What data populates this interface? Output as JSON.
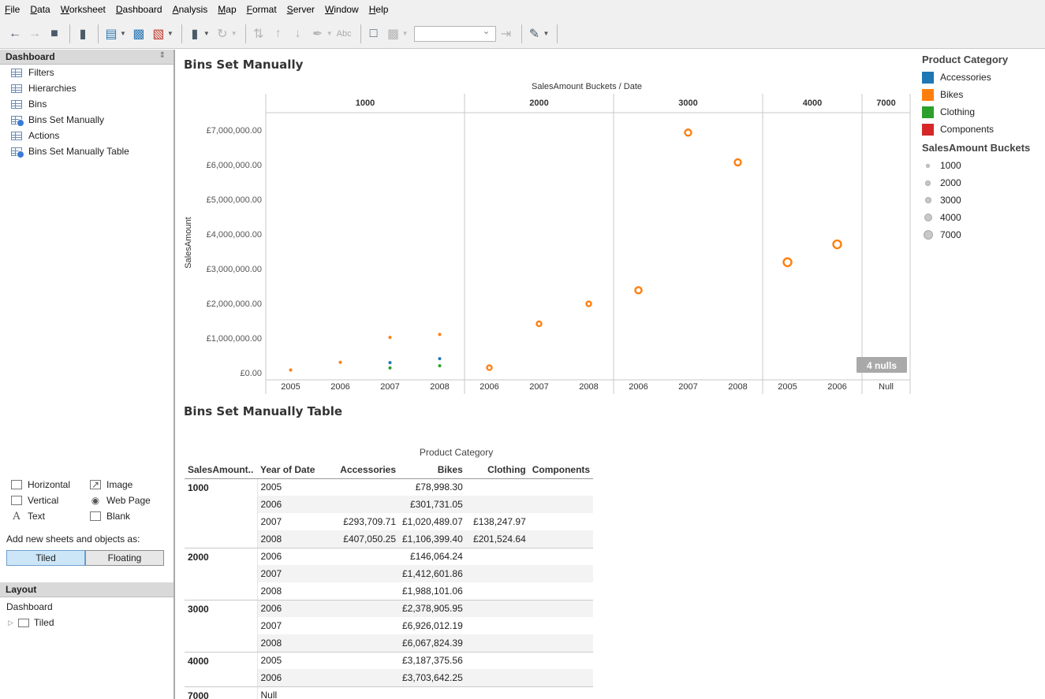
{
  "menu": [
    "File",
    "Data",
    "Worksheet",
    "Dashboard",
    "Analysis",
    "Map",
    "Format",
    "Server",
    "Window",
    "Help"
  ],
  "toolbar": {
    "text_button": "Abc"
  },
  "dashboard_panel": {
    "title": "Dashboard",
    "sheets": [
      {
        "label": "Filters",
        "used": false
      },
      {
        "label": "Hierarchies",
        "used": false
      },
      {
        "label": "Bins",
        "used": false
      },
      {
        "label": "Bins Set Manually",
        "used": true
      },
      {
        "label": "Actions",
        "used": false
      },
      {
        "label": "Bins Set Manually Table",
        "used": true
      }
    ]
  },
  "objects": {
    "horizontal": "Horizontal",
    "image": "Image",
    "vertical": "Vertical",
    "web_page": "Web Page",
    "text": "Text",
    "blank": "Blank"
  },
  "add_new": {
    "label": "Add new sheets and objects as:",
    "tiled": "Tiled",
    "floating": "Floating"
  },
  "layout_panel": {
    "title": "Layout",
    "root": "Dashboard",
    "child": "Tiled"
  },
  "chart_title": "Bins Set Manually",
  "table_title": "Bins Set Manually Table",
  "legend": {
    "color_title": "Product Category",
    "colors": [
      {
        "label": "Accessories",
        "color": "#1f77b4"
      },
      {
        "label": "Bikes",
        "color": "#ff7f0e"
      },
      {
        "label": "Clothing",
        "color": "#2ca02c"
      },
      {
        "label": "Components",
        "color": "#d62728"
      }
    ],
    "size_title": "SalesAmount Buckets",
    "sizes": [
      "1000",
      "2000",
      "3000",
      "4000",
      "7000"
    ]
  },
  "chart_data": {
    "type": "scatter",
    "header_title": "SalesAmount Buckets  /  Date",
    "ylabel": "SalesAmount",
    "ylim": [
      0,
      7500000
    ],
    "y_ticks": [
      "£0.00",
      "£1,000,000.00",
      "£2,000,000.00",
      "£3,000,000.00",
      "£4,000,000.00",
      "£5,000,000.00",
      "£6,000,000.00",
      "£7,000,000.00"
    ],
    "y_tick_values": [
      0,
      1000000,
      2000000,
      3000000,
      4000000,
      5000000,
      6000000,
      7000000
    ],
    "null_badge": "4 nulls",
    "panes": [
      {
        "bucket": "1000",
        "years": [
          "2005",
          "2006",
          "2007",
          "2008"
        ]
      },
      {
        "bucket": "2000",
        "years": [
          "2006",
          "2007",
          "2008"
        ]
      },
      {
        "bucket": "3000",
        "years": [
          "2006",
          "2007",
          "2008"
        ]
      },
      {
        "bucket": "4000",
        "years": [
          "2005",
          "2006"
        ]
      },
      {
        "bucket": "7000",
        "years": [
          "Null"
        ]
      }
    ],
    "points": [
      {
        "bucket": "1000",
        "year": "2005",
        "category": "Bikes",
        "value": 78998.3
      },
      {
        "bucket": "1000",
        "year": "2006",
        "category": "Bikes",
        "value": 301731.05
      },
      {
        "bucket": "1000",
        "year": "2007",
        "category": "Accessories",
        "value": 293709.71
      },
      {
        "bucket": "1000",
        "year": "2007",
        "category": "Bikes",
        "value": 1020489.07
      },
      {
        "bucket": "1000",
        "year": "2007",
        "category": "Clothing",
        "value": 138247.97
      },
      {
        "bucket": "1000",
        "year": "2008",
        "category": "Accessories",
        "value": 407050.25
      },
      {
        "bucket": "1000",
        "year": "2008",
        "category": "Bikes",
        "value": 1106399.4
      },
      {
        "bucket": "1000",
        "year": "2008",
        "category": "Clothing",
        "value": 201524.64
      },
      {
        "bucket": "2000",
        "year": "2006",
        "category": "Bikes",
        "value": 146064.24
      },
      {
        "bucket": "2000",
        "year": "2007",
        "category": "Bikes",
        "value": 1412601.86
      },
      {
        "bucket": "2000",
        "year": "2008",
        "category": "Bikes",
        "value": 1988101.06
      },
      {
        "bucket": "3000",
        "year": "2006",
        "category": "Bikes",
        "value": 2378905.95
      },
      {
        "bucket": "3000",
        "year": "2007",
        "category": "Bikes",
        "value": 6926012.19
      },
      {
        "bucket": "3000",
        "year": "2008",
        "category": "Bikes",
        "value": 6067824.39
      },
      {
        "bucket": "4000",
        "year": "2005",
        "category": "Bikes",
        "value": 3187375.56
      },
      {
        "bucket": "4000",
        "year": "2006",
        "category": "Bikes",
        "value": 3703642.25
      }
    ]
  },
  "table": {
    "header_group": "Product Category",
    "columns": [
      "SalesAmount..",
      "Year of Date",
      "Accessories",
      "Bikes",
      "Clothing",
      "Components"
    ],
    "rows": [
      [
        "1000",
        "2005",
        "",
        "£78,998.30",
        "",
        ""
      ],
      [
        "",
        "2006",
        "",
        "£301,731.05",
        "",
        ""
      ],
      [
        "",
        "2007",
        "£293,709.71",
        "£1,020,489.07",
        "£138,247.97",
        ""
      ],
      [
        "",
        "2008",
        "£407,050.25",
        "£1,106,399.40",
        "£201,524.64",
        ""
      ],
      [
        "2000",
        "2006",
        "",
        "£146,064.24",
        "",
        ""
      ],
      [
        "",
        "2007",
        "",
        "£1,412,601.86",
        "",
        ""
      ],
      [
        "",
        "2008",
        "",
        "£1,988,101.06",
        "",
        ""
      ],
      [
        "3000",
        "2006",
        "",
        "£2,378,905.95",
        "",
        ""
      ],
      [
        "",
        "2007",
        "",
        "£6,926,012.19",
        "",
        ""
      ],
      [
        "",
        "2008",
        "",
        "£6,067,824.39",
        "",
        ""
      ],
      [
        "4000",
        "2005",
        "",
        "£3,187,375.56",
        "",
        ""
      ],
      [
        "",
        "2006",
        "",
        "£3,703,642.25",
        "",
        ""
      ],
      [
        "7000",
        "Null",
        "",
        "",
        "",
        ""
      ]
    ]
  }
}
